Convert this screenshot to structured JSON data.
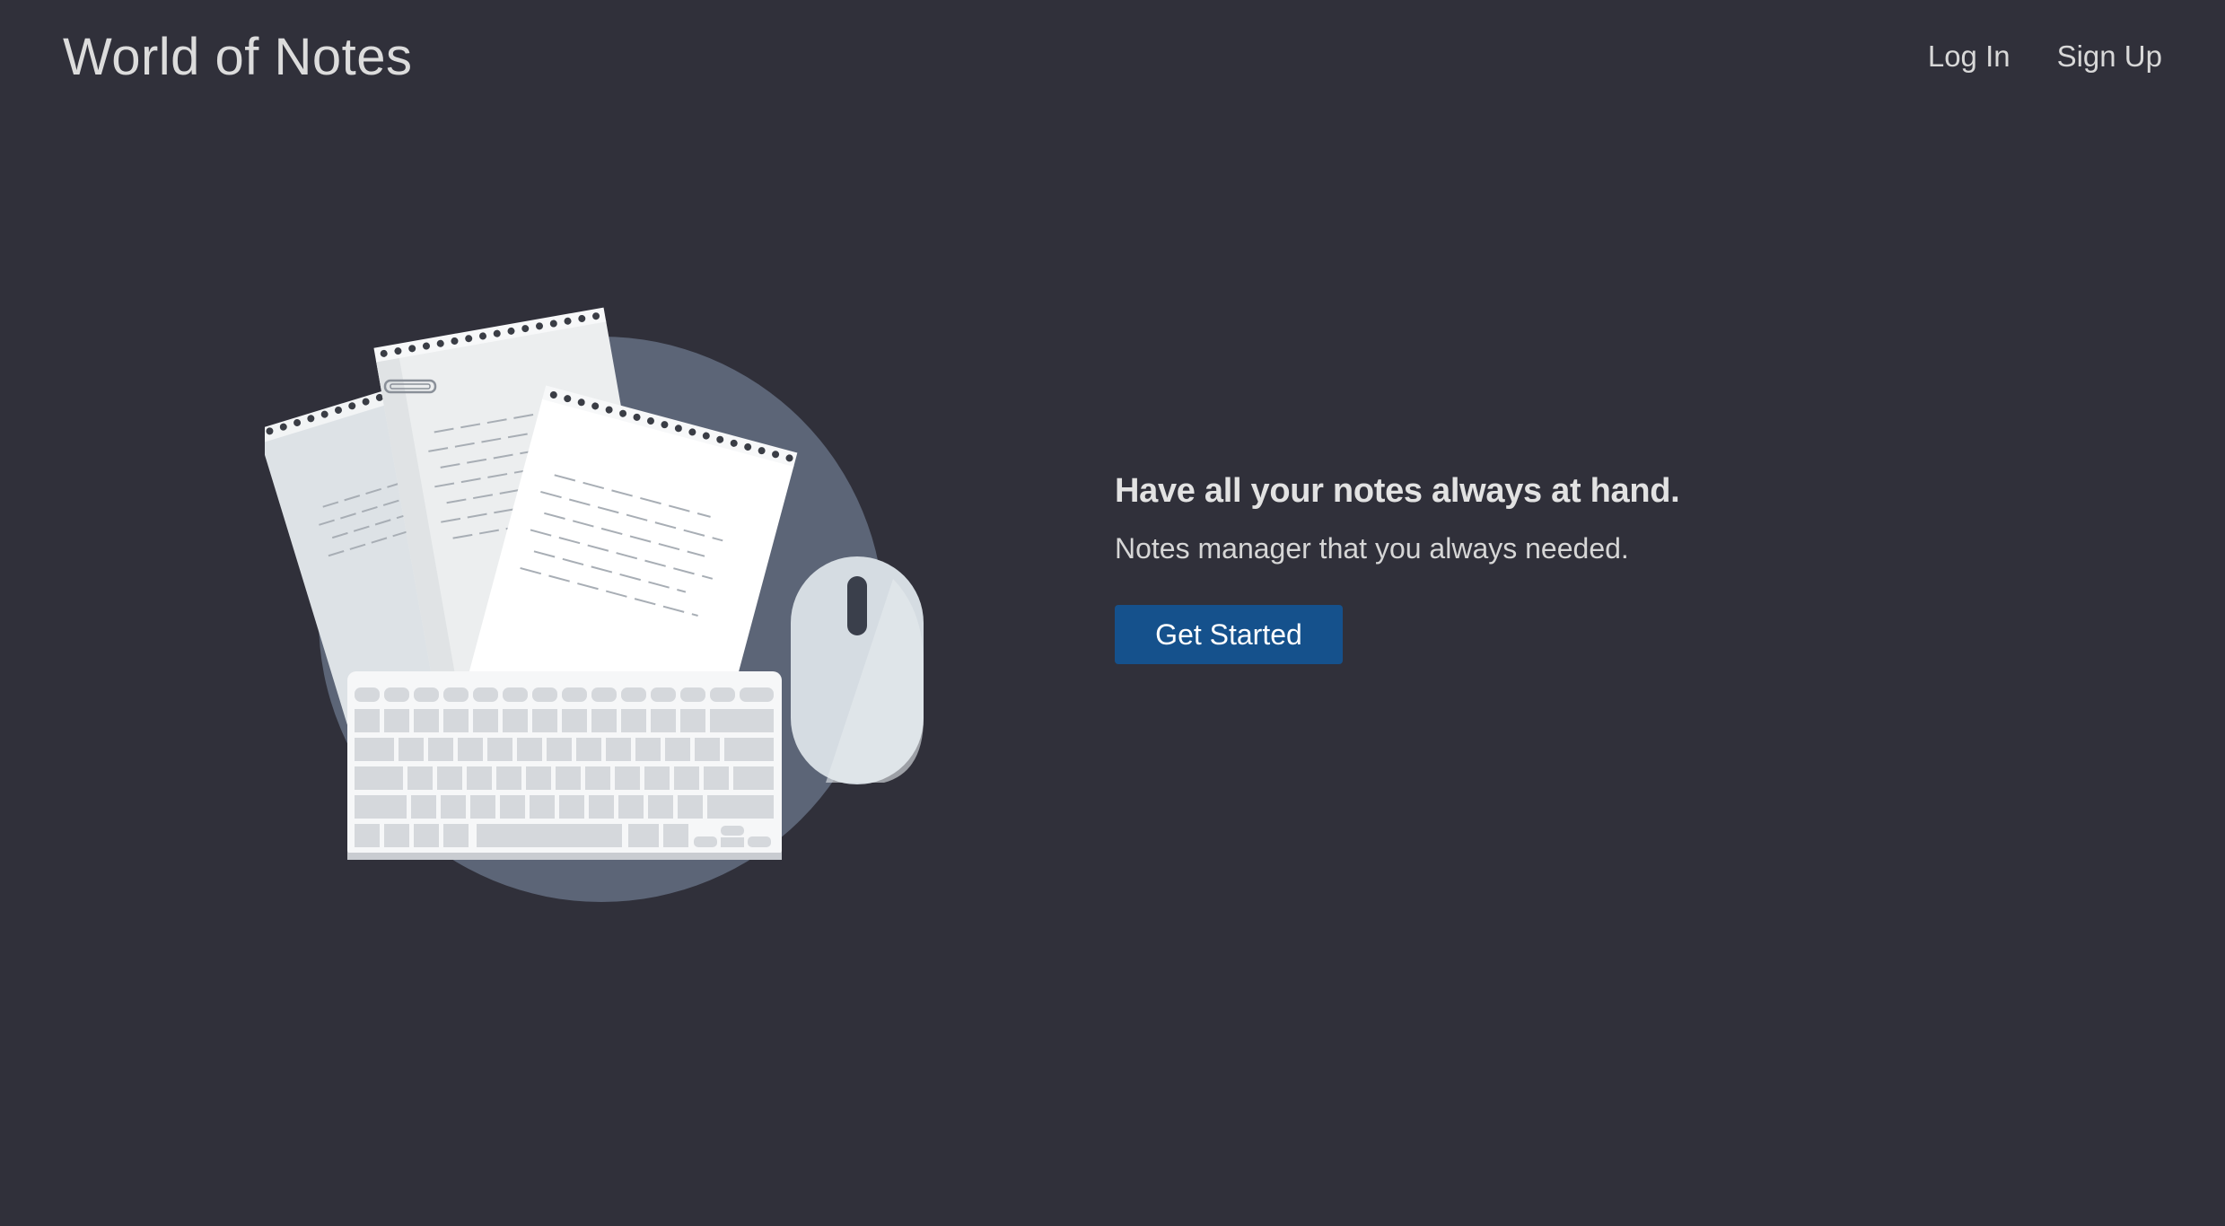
{
  "header": {
    "brand": "World of Notes",
    "nav": {
      "login_label": "Log In",
      "signup_label": "Sign Up"
    }
  },
  "hero": {
    "headline": "Have all your notes always at hand.",
    "subtext": "Notes manager that you always needed.",
    "cta_label": "Get Started"
  },
  "illustration": {
    "icons": [
      "notepad-icon",
      "keyboard-icon",
      "mouse-icon",
      "paperclip-icon"
    ]
  },
  "colors": {
    "background": "#30303a",
    "accent_button": "#15518c",
    "circle": "#5c6577",
    "paper": "#f2f4f5",
    "keys": "#d5d8dc"
  }
}
